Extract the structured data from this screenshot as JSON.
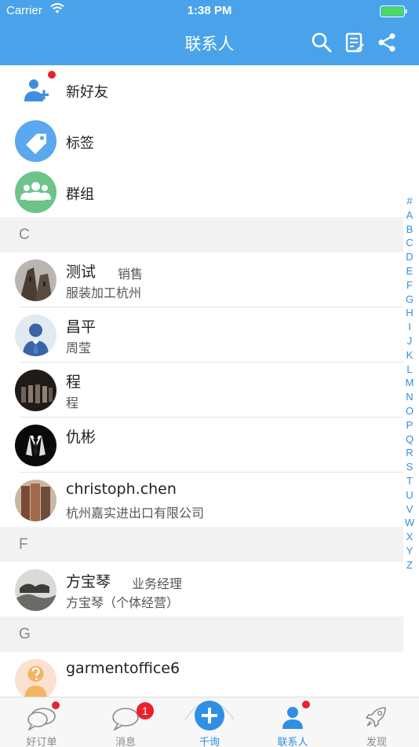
{
  "status_bar": {
    "carrier": "Carrier",
    "time": "1:38 PM"
  },
  "header": {
    "title": "联系人"
  },
  "fixed_items": [
    {
      "label": "新好友"
    },
    {
      "label": "标签"
    },
    {
      "label": "群组"
    }
  ],
  "sections": [
    {
      "letter": "C"
    },
    {
      "letter": "F"
    },
    {
      "letter": "G"
    }
  ],
  "contacts": [
    {
      "name": "测试",
      "role": "销售",
      "sub": "服装加工杭州"
    },
    {
      "name": "昌平",
      "role": "",
      "sub": "周莹"
    },
    {
      "name": "程",
      "role": "",
      "sub": "程"
    },
    {
      "name": "仇彬",
      "role": "",
      "sub": ""
    },
    {
      "name": "christoph.chen",
      "role": "",
      "sub": "杭州嘉实进出口有限公司"
    },
    {
      "name": "方宝琴",
      "role": "业务经理",
      "sub": "方宝琴（个体经营）"
    },
    {
      "name": "garmentoffice6",
      "role": "",
      "sub": ""
    }
  ],
  "index_letters": [
    "#",
    "A",
    "B",
    "C",
    "D",
    "E",
    "F",
    "G",
    "H",
    "I",
    "J",
    "K",
    "L",
    "M",
    "N",
    "O",
    "P",
    "Q",
    "R",
    "S",
    "T",
    "U",
    "V",
    "W",
    "X",
    "Y",
    "Z"
  ],
  "tabs": [
    {
      "label": "好订单"
    },
    {
      "label": "消息",
      "badge": "1"
    },
    {
      "label": "千询"
    },
    {
      "label": "联系人"
    },
    {
      "label": "发现"
    }
  ],
  "colors": {
    "header": "#4aa3ea",
    "accent": "#2f8fe3",
    "badge": "#e8212c",
    "section_bg": "#f2f2f2"
  },
  "icons": [
    "wifi-icon",
    "battery-icon",
    "search-icon",
    "notepad-icon",
    "share-icon",
    "new-friend-icon",
    "tag-icon",
    "group-icon",
    "chat-bubbles-icon",
    "chat-bubble-icon",
    "plus-icon",
    "person-icon",
    "rocket-icon"
  ]
}
